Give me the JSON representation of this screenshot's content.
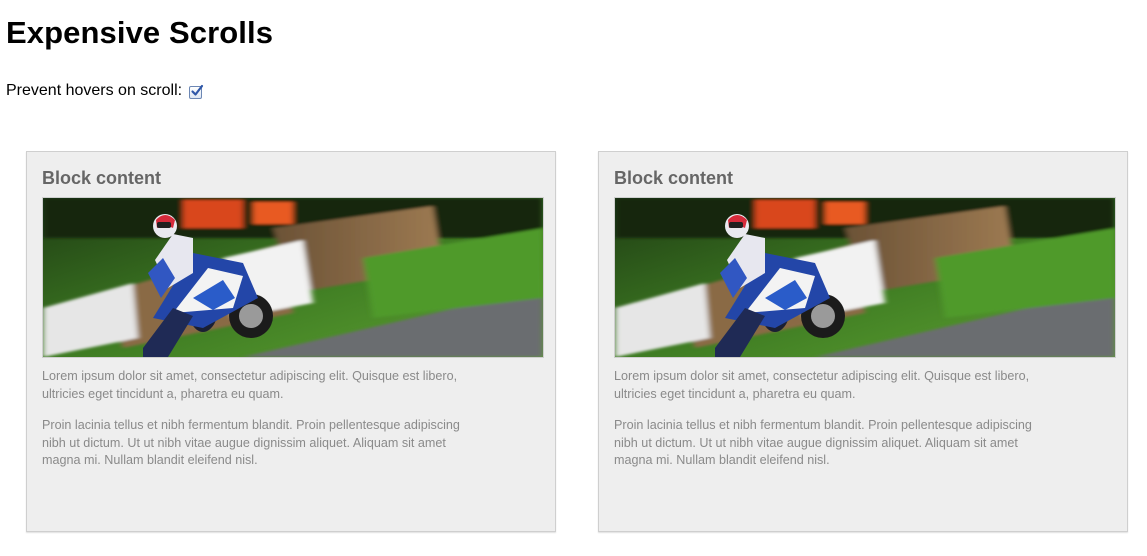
{
  "page": {
    "title": "Expensive Scrolls"
  },
  "option": {
    "label": "Prevent hovers on scroll:",
    "checked": true
  },
  "blocks": [
    {
      "heading": "Block content",
      "image_icon": "motorcycle-racer-photo",
      "paragraphs": [
        "Lorem ipsum dolor sit amet, consectetur adipiscing elit. Quisque est libero, ultricies eget tincidunt a, pharetra eu quam.",
        "Proin lacinia tellus et nibh fermentum blandit. Proin pellentesque adipiscing nibh ut dictum. Ut ut nibh vitae augue dignissim aliquet. Aliquam sit amet magna mi. Nullam blandit eleifend nisl."
      ]
    },
    {
      "heading": "Block content",
      "image_icon": "motorcycle-racer-photo",
      "paragraphs": [
        "Lorem ipsum dolor sit amet, consectetur adipiscing elit. Quisque est libero, ultricies eget tincidunt a, pharetra eu quam.",
        "Proin lacinia tellus et nibh fermentum blandit. Proin pellentesque adipiscing nibh ut dictum. Ut ut nibh vitae augue dignissim aliquet. Aliquam sit amet magna mi. Nullam blandit eleifend nisl."
      ]
    }
  ],
  "colors": {
    "block_bg": "#eeeeee",
    "heading": "#666666",
    "body_text": "#8a8a8a",
    "checkbox_accent": "#2f57a8"
  }
}
